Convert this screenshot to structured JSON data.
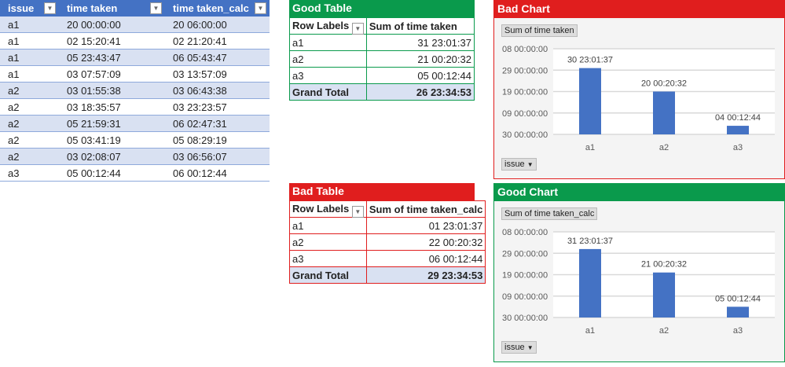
{
  "source_table": {
    "headers": [
      "issue",
      "time taken",
      "time taken_calc"
    ],
    "rows": [
      [
        "a1",
        "20 00:00:00",
        "20 06:00:00"
      ],
      [
        "a1",
        "02 15:20:41",
        "02 21:20:41"
      ],
      [
        "a1",
        "05 23:43:47",
        "06 05:43:47"
      ],
      [
        "a1",
        "03 07:57:09",
        "03 13:57:09"
      ],
      [
        "a2",
        "03 01:55:38",
        "03 06:43:38"
      ],
      [
        "a2",
        "03 18:35:57",
        "03 23:23:57"
      ],
      [
        "a2",
        "05 21:59:31",
        "06 02:47:31"
      ],
      [
        "a2",
        "05 03:41:19",
        "05 08:29:19"
      ],
      [
        "a2",
        "03 02:08:07",
        "03 06:56:07"
      ],
      [
        "a3",
        "05 00:12:44",
        "06 00:12:44"
      ]
    ]
  },
  "good_table": {
    "title": "Good Table",
    "row_labels": "Row Labels",
    "value_header": "Sum of time taken",
    "rows": [
      [
        "a1",
        "31 23:01:37"
      ],
      [
        "a2",
        "21 00:20:32"
      ],
      [
        "a3",
        "05 00:12:44"
      ]
    ],
    "total_label": "Grand Total",
    "total": "26 23:34:53",
    "color": "#0a9a4c"
  },
  "bad_table": {
    "title": "Bad Table",
    "row_labels": "Row Labels",
    "value_header": "Sum of time taken_calc",
    "rows": [
      [
        "a1",
        "01 23:01:37"
      ],
      [
        "a2",
        "22 00:20:32"
      ],
      [
        "a3",
        "06 00:12:44"
      ]
    ],
    "total_label": "Grand Total",
    "total": "29 23:34:53",
    "color": "#e01e1e"
  },
  "chart_data": [
    {
      "type": "bar",
      "title": "Bad Chart",
      "series_button": "Sum of time taken",
      "axis_button": "issue",
      "categories": [
        "a1",
        "a2",
        "a3"
      ],
      "values": [
        30.96,
        20.01,
        4.01
      ],
      "data_labels": [
        "30 23:01:37",
        "20 00:20:32",
        "04 00:12:44"
      ],
      "ylim": [
        0,
        40
      ],
      "yticks": [
        0,
        10,
        20,
        30,
        40
      ],
      "ytick_labels": [
        "30 00:00:00",
        "09 00:00:00",
        "19 00:00:00",
        "29 00:00:00",
        "08 00:00:00"
      ],
      "color": "#e01e1e",
      "bar_color": "#4472c4"
    },
    {
      "type": "bar",
      "title": "Good Chart",
      "series_button": "Sum of time taken_calc",
      "axis_button": "issue",
      "categories": [
        "a1",
        "a2",
        "a3"
      ],
      "values": [
        31.96,
        21.01,
        5.01
      ],
      "data_labels": [
        "31 23:01:37",
        "21 00:20:32",
        "05 00:12:44"
      ],
      "ylim": [
        0,
        40
      ],
      "yticks": [
        0,
        10,
        20,
        30,
        40
      ],
      "ytick_labels": [
        "30 00:00:00",
        "09 00:00:00",
        "19 00:00:00",
        "29 00:00:00",
        "08 00:00:00"
      ],
      "color": "#0a9a4c",
      "bar_color": "#4472c4"
    }
  ]
}
